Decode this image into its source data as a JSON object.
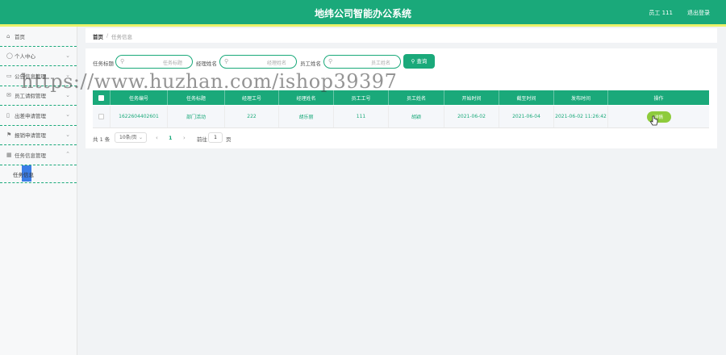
{
  "header": {
    "title": "地纬公司智能办公系统",
    "user": "员工 111",
    "logout": "退出登录"
  },
  "sidebar": {
    "items": [
      {
        "label": "首页",
        "icon": "home-icon",
        "glyph": "⌂",
        "expanded": false
      },
      {
        "label": "个人中心",
        "icon": "user-icon",
        "glyph": "◯",
        "chevron": "⌄"
      },
      {
        "label": "公告信息管理",
        "icon": "chat-icon",
        "glyph": "▭",
        "chevron": "⌄"
      },
      {
        "label": "员工请假管理",
        "icon": "mail-icon",
        "glyph": "✉",
        "chevron": "⌄"
      },
      {
        "label": "出差申请管理",
        "icon": "doc-icon",
        "glyph": "▯",
        "chevron": "⌄"
      },
      {
        "label": "报销申请管理",
        "icon": "flag-icon",
        "glyph": "⚑",
        "chevron": "⌄"
      },
      {
        "label": "任务信息管理",
        "icon": "grid-icon",
        "glyph": "▦",
        "chevron": "⌃"
      }
    ],
    "submenu": {
      "label": "任务信息"
    }
  },
  "breadcrumb": {
    "home": "首页",
    "separator": "/",
    "current": "任务信息"
  },
  "filters": {
    "task_title": {
      "label": "任务标题",
      "placeholder": "任务标题"
    },
    "manager_name": {
      "label": "经理姓名",
      "placeholder": "经理姓名"
    },
    "employee_name": {
      "label": "员工姓名",
      "placeholder": "员工姓名"
    },
    "search_button": "查询",
    "search_glyph": "⚲"
  },
  "table": {
    "columns": [
      "任务编号",
      "任务标题",
      "经理工号",
      "经理姓名",
      "员工工号",
      "员工姓名",
      "开始时间",
      "截至时间",
      "发布时间",
      "操作"
    ],
    "rows": [
      {
        "cells": [
          "1622604402601",
          "部门活动",
          "222",
          "胡乐丽",
          "111",
          "胡颖",
          "2021-06-02",
          "2021-06-04",
          "2021-06-02 11:26:42"
        ],
        "action": "详情"
      }
    ]
  },
  "pagination": {
    "total": "共 1 条",
    "page_size": "10条/页",
    "prev": "‹",
    "page": "1",
    "next": "›",
    "goto_label": "前往",
    "goto_value": "1",
    "page_unit": "页"
  },
  "watermark": "https://www.huzhan.com/ishop39397",
  "colors": {
    "primary": "#1aa97a",
    "accent_line": "#eaf26a",
    "detail_button": "#8ecb3c",
    "submenu_highlight": "#3b7de6"
  }
}
